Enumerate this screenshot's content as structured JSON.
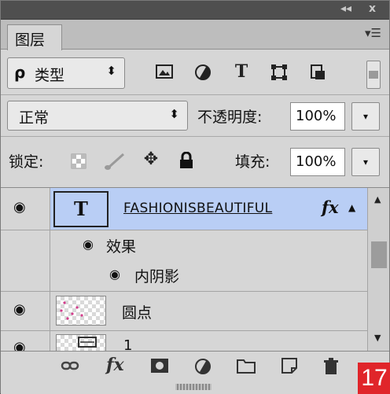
{
  "titlebar": {
    "collapse_icon": "double-chevron-icon",
    "close_glyph": "x"
  },
  "tab": {
    "label": "图层"
  },
  "filter": {
    "search_glyph": "ρ",
    "kind_value": "类型",
    "icons": [
      "image-filter-icon",
      "adjustment-filter-icon",
      "type-filter-icon",
      "shape-filter-icon",
      "smartobject-filter-icon"
    ],
    "type_glyph": "T"
  },
  "blend": {
    "mode_value": "正常",
    "opacity_label": "不透明度:",
    "opacity_value": "100%"
  },
  "lock": {
    "label": "锁定:",
    "fill_label": "填充:",
    "fill_value": "100%"
  },
  "layers": [
    {
      "name": "FASHIONISBEAUTIFUL",
      "type_glyph": "T",
      "fx": "fx",
      "selected": true
    },
    {
      "name": "效果",
      "kind": "effects-group"
    },
    {
      "name": "内阴影",
      "kind": "effect"
    },
    {
      "name": "圆点",
      "kind": "pixel"
    },
    {
      "name": "1",
      "kind": "partial"
    }
  ],
  "bottom": {
    "icons": [
      "link-icon",
      "fx-icon",
      "mask-icon",
      "adjustment-icon",
      "folder-icon",
      "new-layer-icon",
      "trash-icon"
    ],
    "fx_glyph": "fx"
  },
  "badge": "17",
  "colors": {
    "selected_row": "#b9cef5",
    "badge": "#e0252a",
    "panel": "#d6d6d6"
  }
}
